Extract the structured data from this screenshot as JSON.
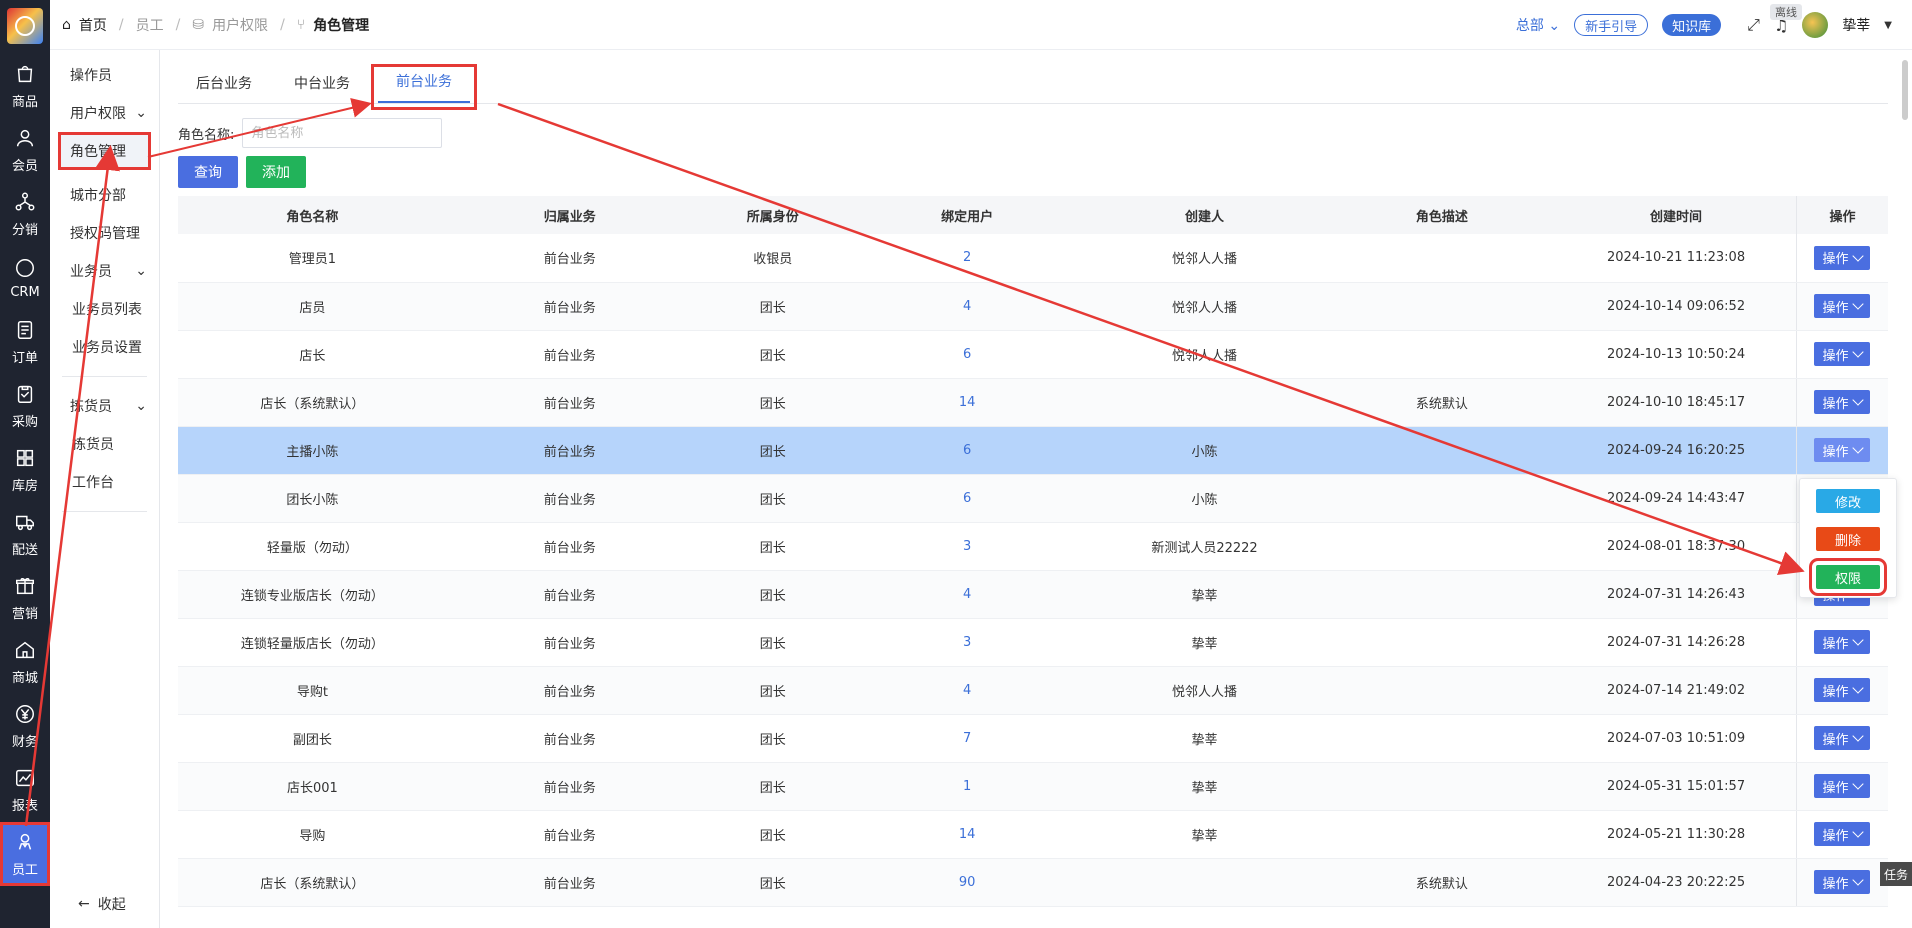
{
  "rail": {
    "items": [
      {
        "label": "商品",
        "icon": "bag-icon"
      },
      {
        "label": "会员",
        "icon": "user-icon"
      },
      {
        "label": "分销",
        "icon": "share-icon"
      },
      {
        "label": "CRM",
        "icon": "crm-icon"
      },
      {
        "label": "订单",
        "icon": "order-icon"
      },
      {
        "label": "采购",
        "icon": "clipboard-icon"
      },
      {
        "label": "库房",
        "icon": "warehouse-icon"
      },
      {
        "label": "配送",
        "icon": "truck-icon"
      },
      {
        "label": "营销",
        "icon": "gift-icon"
      },
      {
        "label": "商城",
        "icon": "home-icon"
      },
      {
        "label": "财务",
        "icon": "yen-icon"
      },
      {
        "label": "报表",
        "icon": "chart-icon"
      },
      {
        "label": "员工",
        "icon": "staff-icon"
      }
    ]
  },
  "sidebar": {
    "operator": "操作员",
    "user_perm": "用户权限",
    "role_mgmt": "角色管理",
    "city_branch": "城市分部",
    "auth_code": "授权码管理",
    "salesman": "业务员",
    "salesman_list": "业务员列表",
    "salesman_settings": "业务员设置",
    "picker_group": "拣货员",
    "picker": "拣货员",
    "workbench": "工作台",
    "collapse": "收起"
  },
  "breadcrumb": {
    "home": "首页",
    "staff": "员工",
    "perm": "用户权限",
    "current": "角色管理"
  },
  "header": {
    "hq": "总部",
    "guide": "新手引导",
    "knowledge": "知识库",
    "offline": "离线",
    "username": "挚莘"
  },
  "tabs": [
    "后台业务",
    "中台业务",
    "前台业务"
  ],
  "filter": {
    "label": "角色名称:",
    "placeholder": "角色名称"
  },
  "buttons": {
    "query": "查询",
    "add": "添加"
  },
  "table": {
    "headers": [
      "角色名称",
      "归属业务",
      "所属身份",
      "绑定用户",
      "创建人",
      "角色描述",
      "创建时间",
      "操作"
    ],
    "op_label": "操作",
    "rows": [
      [
        "管理员1",
        "前台业务",
        "收银员",
        "2",
        "悦邻人人播",
        "",
        "2024-10-21 11:23:08"
      ],
      [
        "店员",
        "前台业务",
        "团长",
        "4",
        "悦邻人人播",
        "",
        "2024-10-14 09:06:52"
      ],
      [
        "店长",
        "前台业务",
        "团长",
        "6",
        "悦邻人人播",
        "",
        "2024-10-13 10:50:24"
      ],
      [
        "店长（系统默认）",
        "前台业务",
        "团长",
        "14",
        "",
        "系统默认",
        "2024-10-10 18:45:17"
      ],
      [
        "主播小陈",
        "前台业务",
        "团长",
        "6",
        "小陈",
        "",
        "2024-09-24 16:20:25"
      ],
      [
        "团长小陈",
        "前台业务",
        "团长",
        "6",
        "小陈",
        "",
        "2024-09-24 14:43:47"
      ],
      [
        "轻量版（勿动）",
        "前台业务",
        "团长",
        "3",
        "新测试人员22222",
        "",
        "2024-08-01 18:37:30"
      ],
      [
        "连锁专业版店长（勿动）",
        "前台业务",
        "团长",
        "4",
        "挚莘",
        "",
        "2024-07-31 14:26:43"
      ],
      [
        "连锁轻量版店长（勿动）",
        "前台业务",
        "团长",
        "3",
        "挚莘",
        "",
        "2024-07-31 14:26:28"
      ],
      [
        "导购t",
        "前台业务",
        "团长",
        "4",
        "悦邻人人播",
        "",
        "2024-07-14 21:49:02"
      ],
      [
        "副团长",
        "前台业务",
        "团长",
        "7",
        "挚莘",
        "",
        "2024-07-03 10:51:09"
      ],
      [
        "店长001",
        "前台业务",
        "团长",
        "1",
        "挚莘",
        "",
        "2024-05-31 15:01:57"
      ],
      [
        "导购",
        "前台业务",
        "团长",
        "14",
        "挚莘",
        "",
        "2024-05-21 11:30:28"
      ],
      [
        "店长（系统默认）",
        "前台业务",
        "团长",
        "90",
        "",
        "系统默认",
        "2024-04-23 20:22:25"
      ]
    ]
  },
  "dropdown": {
    "edit": "修改",
    "delete": "删除",
    "perm": "权限"
  },
  "task": "任务",
  "colors": {
    "accent": "#3b6fd8",
    "rail": "#1f2430",
    "highlight": "#e53935"
  }
}
